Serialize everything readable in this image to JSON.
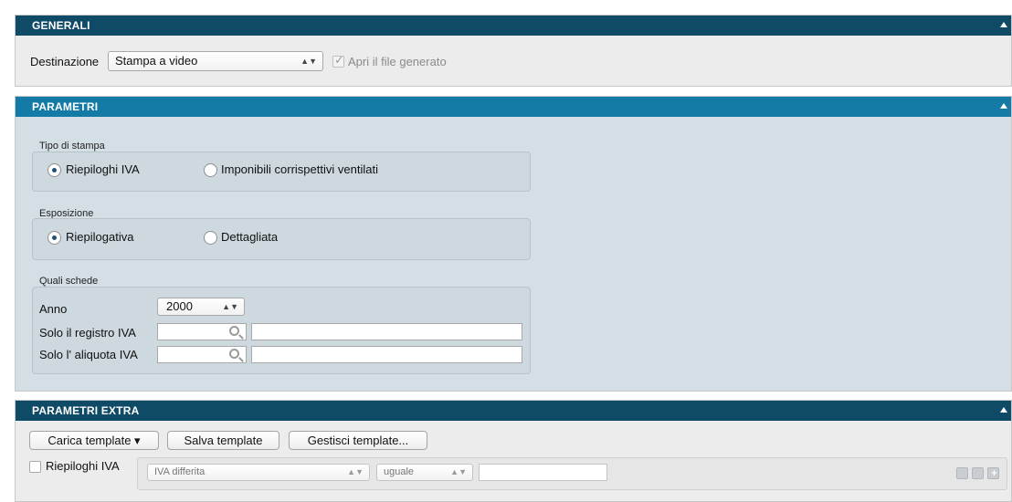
{
  "generali": {
    "title": "GENERALI",
    "destinazione_label": "Destinazione",
    "destinazione_value": "Stampa a video",
    "apri_file_label": "Apri il file generato"
  },
  "parametri": {
    "title": "PARAMETRI",
    "tipo_stampa": {
      "title": "Tipo di stampa",
      "options": [
        "Riepiloghi IVA",
        "Imponibili corrispettivi ventilati"
      ],
      "selected": "Riepiloghi IVA"
    },
    "esposizione": {
      "title": "Esposizione",
      "options": [
        "Riepilogativa",
        "Dettagliata"
      ],
      "selected": "Riepilogativa"
    },
    "quali_schede": {
      "title": "Quali schede",
      "anno_label": "Anno",
      "anno_value": "2000",
      "registro_label": "Solo il registro IVA",
      "aliquota_label": "Solo l' aliquota IVA"
    }
  },
  "extra": {
    "title": "PARAMETRI EXTRA",
    "carica_label": "Carica template ▾",
    "salva_label": "Salva template",
    "gestisci_label": "Gestisci template...",
    "riepiloghi_label": "Riepiloghi IVA",
    "field_value": "IVA differita",
    "operator_value": "uguale"
  }
}
